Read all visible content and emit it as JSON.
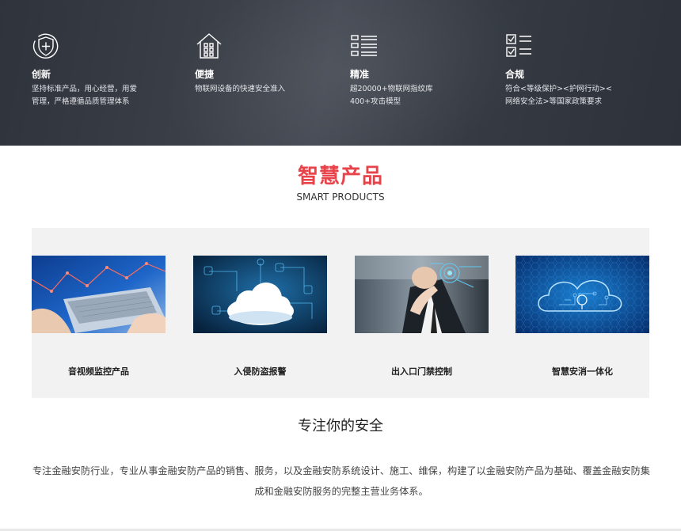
{
  "features": [
    {
      "icon": "shield-plus-icon",
      "title": "创新",
      "desc_lines": [
        "坚持标准产品，用心经营，用爱",
        "管理，严格遵循品质管理体系"
      ]
    },
    {
      "icon": "house-grid-icon",
      "title": "便捷",
      "desc_lines": [
        "物联网设备的快速安全准入"
      ]
    },
    {
      "icon": "list-icon",
      "title": "精准",
      "desc_lines": [
        "超20000+物联网指纹库",
        "400+攻击模型"
      ]
    },
    {
      "icon": "checklist-icon",
      "title": "合规",
      "desc_lines": [
        "符合<等级保护><护网行动><",
        "网络安全法>等国家政策要求"
      ]
    }
  ],
  "section": {
    "title_cn": "智慧产品",
    "title_en": "SMART PRODUCTS"
  },
  "products": [
    {
      "name": "音视频监控产品",
      "image": "laptop-analytics-image"
    },
    {
      "name": "入侵防盗报警",
      "image": "cloud-network-image"
    },
    {
      "name": "出入口门禁控制",
      "image": "touch-interface-image"
    },
    {
      "name": "智慧安消一体化",
      "image": "circuit-cloud-image"
    }
  ],
  "about": {
    "title": "专注你的安全",
    "text": "专注金融安防行业，专业从事金融安防产品的销售、服务，以及金融安防系统设计、施工、维保，构建了以金融安防产品为基础、覆盖金融安防集成和金融安防服务的完整主营业务体系。"
  },
  "colors": {
    "accent": "#e8434a",
    "dark_band": "#3a3f48",
    "panel": "#f2f2f2"
  }
}
